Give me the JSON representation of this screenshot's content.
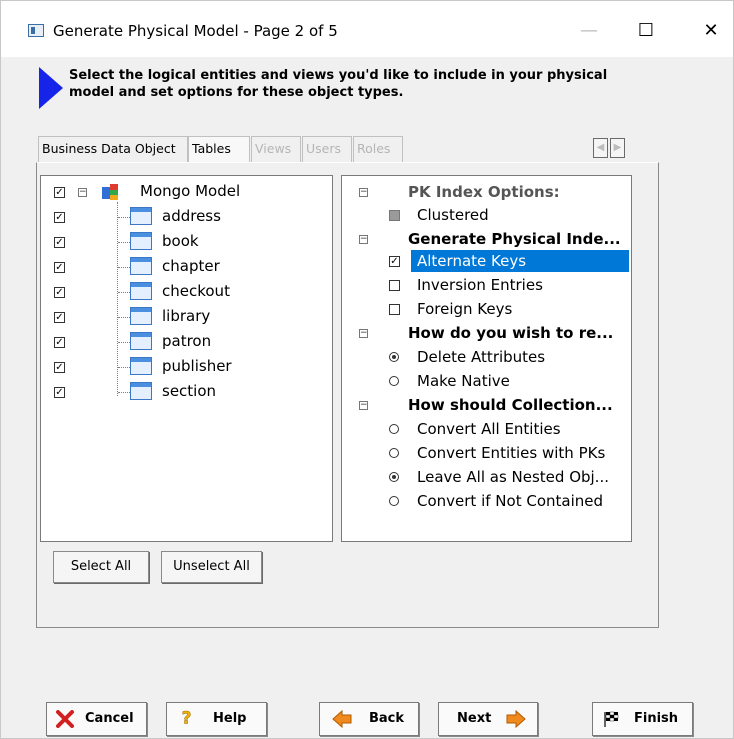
{
  "window": {
    "title": "Generate Physical Model - Page 2 of 5",
    "minimize": "—",
    "maximize": "☐",
    "close": "✕"
  },
  "instruction": "Select the logical entities and views you'd like to include in your physical model and set options for these object types.",
  "tabs": [
    {
      "label": "Business Data Object",
      "state": "normal"
    },
    {
      "label": "Tables",
      "state": "active"
    },
    {
      "label": "Views",
      "state": "disabled"
    },
    {
      "label": "Users",
      "state": "disabled"
    },
    {
      "label": "Roles",
      "state": "disabled"
    }
  ],
  "tree": {
    "root": {
      "label": "Mongo Model",
      "checked": true
    },
    "items": [
      {
        "label": "address",
        "checked": true
      },
      {
        "label": "book",
        "checked": true
      },
      {
        "label": "chapter",
        "checked": true
      },
      {
        "label": "checkout",
        "checked": true
      },
      {
        "label": "library",
        "checked": true
      },
      {
        "label": "patron",
        "checked": true
      },
      {
        "label": "publisher",
        "checked": true
      },
      {
        "label": "section",
        "checked": true
      }
    ]
  },
  "options": {
    "pk_header": "PK Index Options:",
    "clustered": "Clustered",
    "gen_header": "Generate Physical Inde...",
    "alternate_keys": "Alternate Keys",
    "inversion_entries": "Inversion Entries",
    "foreign_keys": "Foreign Keys",
    "how_header": "How do you wish to re...",
    "delete_attributes": "Delete Attributes",
    "make_native": "Make Native",
    "collection_header": "How should Collection...",
    "convert_all": "Convert All Entities",
    "convert_pks": "Convert Entities with PKs",
    "leave_nested": "Leave All as Nested Obj...",
    "convert_not_contained": "Convert if Not Contained"
  },
  "buttons": {
    "select_all": "Select All",
    "unselect_all": "Unselect All",
    "cancel": "Cancel",
    "help": "Help",
    "back": "Back",
    "next": "Next",
    "finish": "Finish"
  },
  "colors": {
    "accent_arrow": "#1524e8",
    "selection": "#0078d7"
  }
}
